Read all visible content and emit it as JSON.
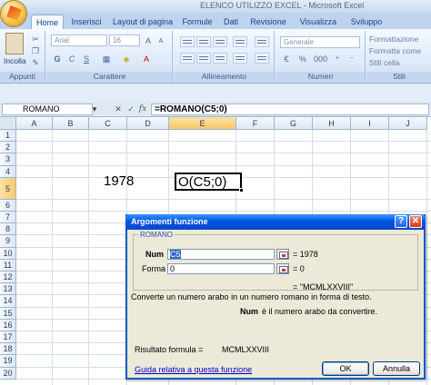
{
  "window": {
    "title": "ELENCO UTILIZZO EXCEL - Microsoft Excel"
  },
  "tabs": [
    "Home",
    "Inserisci",
    "Layout di pagina",
    "Formule",
    "Dati",
    "Revisione",
    "Visualizza",
    "Sviluppo"
  ],
  "ribbon": {
    "paste_label": "Incolla",
    "font_name": "Arial",
    "font_size": "16",
    "number_format": "Generale",
    "formatting_cond": "Formattazione",
    "format_as_table": "Formatta come",
    "cell_styles": "Stili cella",
    "groups": [
      "Appunti",
      "Carattere",
      "Allineamento",
      "Numeri",
      "Stili"
    ]
  },
  "formula_bar": {
    "name_box": "ROMANO",
    "cancel": "✕",
    "enter": "✓",
    "fx": "fx",
    "formula": "=ROMANO(C5;0)"
  },
  "grid": {
    "columns": [
      "A",
      "B",
      "C",
      "D",
      "E",
      "F",
      "G",
      "H",
      "I",
      "J"
    ],
    "rows": [
      "1",
      "2",
      "3",
      "4",
      "5",
      "6",
      "7",
      "8",
      "9",
      "10",
      "11",
      "12",
      "13",
      "14",
      "15",
      "16",
      "17",
      "18",
      "19",
      "20"
    ],
    "selected_column": "E",
    "selected_row": "5",
    "cells": {
      "C5": "1978",
      "E5": "O(C5;0)"
    }
  },
  "dialog": {
    "title": "Argomenti funzione",
    "help": "?",
    "close": "✕",
    "function_name": "ROMANO",
    "args": [
      {
        "label": "Num",
        "value": "C5",
        "result": "= 1978"
      },
      {
        "label": "Forma",
        "value": "0",
        "result": "= 0"
      }
    ],
    "overall_result": "= \"MCMLXXVIII\"",
    "description": "Converte un numero arabo in un numero romano in forma di testo.",
    "arg_help_name": "Num",
    "arg_help_text": "è il numero arabo da convertire.",
    "result_label": "Risultato formula =",
    "result_value": "MCMLXXVIII",
    "help_link": "Guida relativa a questa funzione",
    "ok": "OK",
    "cancel": "Annulla"
  }
}
